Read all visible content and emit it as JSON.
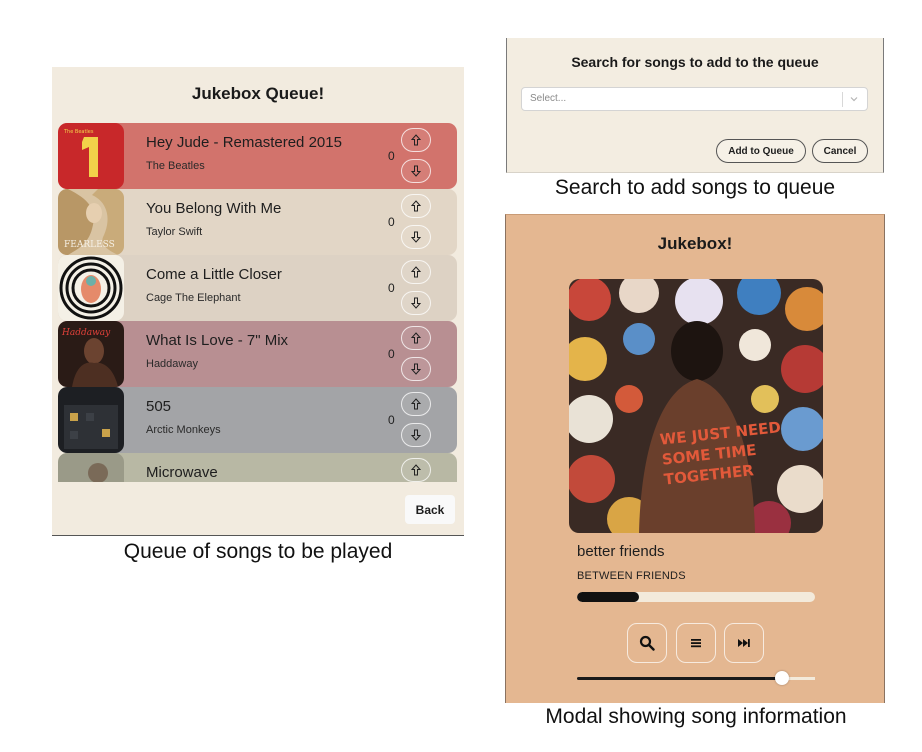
{
  "queue": {
    "title": "Jukebox Queue!",
    "back_label": "Back",
    "songs": [
      {
        "title": "Hey Jude - Remastered 2015",
        "artist": "The Beatles",
        "votes": "0",
        "row_color": "#d2736c",
        "art_icon": "beatles-1-cover"
      },
      {
        "title": "You Belong With Me",
        "artist": "Taylor Swift",
        "votes": "0",
        "row_color": "#e2d6c6",
        "art_icon": "fearless-cover"
      },
      {
        "title": "Come a Little Closer",
        "artist": "Cage The Elephant",
        "votes": "0",
        "row_color": "#ddd2c4",
        "art_icon": "melophobia-cover"
      },
      {
        "title": "What Is Love - 7\" Mix",
        "artist": "Haddaway",
        "votes": "0",
        "row_color": "#b88f92",
        "art_icon": "haddaway-cover"
      },
      {
        "title": "505",
        "artist": "Arctic Monkeys",
        "votes": "0",
        "row_color": "#a3a4a7",
        "art_icon": "favourite-worst-nightmare-cover"
      },
      {
        "title": "Microwave",
        "artist": "",
        "votes": "",
        "row_color": "#b8b8a4",
        "art_icon": "microwave-cover"
      }
    ]
  },
  "search": {
    "title": "Search for songs to add to the queue",
    "placeholder": "Select...",
    "add_label": "Add to Queue",
    "cancel_label": "Cancel"
  },
  "player": {
    "title": "Jukebox!",
    "song": "better friends",
    "artist": "BETWEEN FRIENDS",
    "progress": 0.26,
    "volume": 0.86,
    "controls": [
      "search-icon",
      "queue-list-icon",
      "skip-forward-icon"
    ]
  },
  "captions": {
    "queue": "Queue of songs to be played",
    "search": "Search to add songs to queue",
    "modal": "Modal showing song information"
  },
  "colors": {
    "panel_bg": "#f2ebdf",
    "modal_bg": "#e4b791",
    "progress_fill": "#111111"
  }
}
